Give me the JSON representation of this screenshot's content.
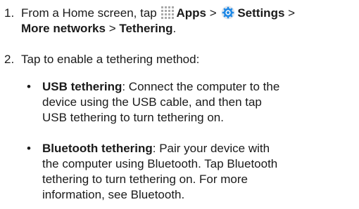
{
  "steps": [
    {
      "number": "1.",
      "text_before_apps": "From a Home screen, tap ",
      "apps_label": "Apps",
      "sep1": " > ",
      "settings_label": "Settings",
      "sep2": " >",
      "more_networks": "More networks",
      "sep3": " > ",
      "tethering": "Tethering",
      "end": "."
    },
    {
      "number": "2.",
      "text": "Tap to enable a tethering method:"
    }
  ],
  "bullets": [
    {
      "marker": "•",
      "title": "USB tethering",
      "text_line1": ": Connect the computer to the",
      "text_line2": "device using the USB cable, and then tap",
      "text_line3": "USB tethering to turn tethering on."
    },
    {
      "marker": "•",
      "title": "Bluetooth tethering",
      "text_line1": ": Pair your device with",
      "text_line2": "the computer using Bluetooth. Tap Bluetooth",
      "text_line3": "tethering to turn tethering on. For more",
      "text_line4": "information, see Bluetooth."
    }
  ],
  "icons": {
    "apps": "apps-grid-icon",
    "settings": "settings-gear-icon",
    "apps_color": "#a9a9a9",
    "settings_color": "#1e88e5"
  }
}
